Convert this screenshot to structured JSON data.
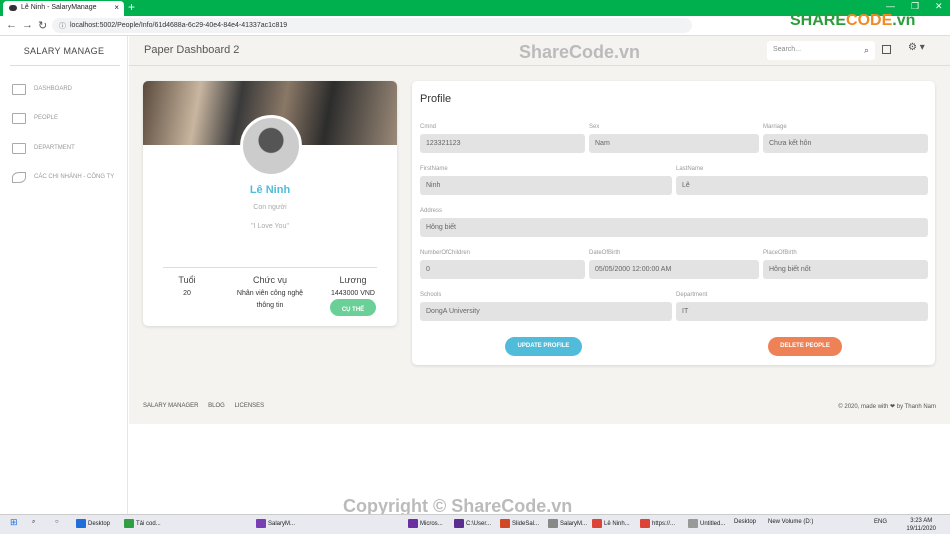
{
  "browser": {
    "tab_title": "Lê Ninh - SalaryManage",
    "url": "localhost:5002/People/Info/61d4688a-6c29-40e4-84e4-41337ac1c819"
  },
  "sidebar": {
    "brand": "SALARY MANAGE",
    "items": [
      {
        "label": "DASHBOARD",
        "icon": "bank-icon"
      },
      {
        "label": "PEOPLE",
        "icon": "id-card-icon"
      },
      {
        "label": "DEPARTMENT",
        "icon": "building-icon"
      },
      {
        "label": "CÁC CHI NHÁNH - CÔNG TY",
        "icon": "rocket-icon"
      }
    ]
  },
  "header": {
    "title": "Paper Dashboard 2",
    "search_placeholder": "Search..."
  },
  "user_card": {
    "name": "Lê Ninh",
    "role": "Con người",
    "quote": "\"I Love You\"",
    "stats": [
      {
        "label": "Tuổi",
        "value": "20"
      },
      {
        "label": "Chức vụ",
        "value": "Nhân viên công nghệ thông tin"
      },
      {
        "label": "Lương",
        "value": "1443000 VND"
      }
    ],
    "button": "CỤ THỂ"
  },
  "profile": {
    "title": "Profile",
    "fields": {
      "cmnd": {
        "label": "Cmnd",
        "value": "123321123"
      },
      "sex": {
        "label": "Sex",
        "value": "Nam"
      },
      "marriage": {
        "label": "Marriage",
        "value": "Chưa kết hôn"
      },
      "firstname": {
        "label": "FirstName",
        "value": "Ninh"
      },
      "lastname": {
        "label": "LastName",
        "value": "Lê"
      },
      "address": {
        "label": "Address",
        "value": "Hông biết"
      },
      "children": {
        "label": "NumberOfChildren",
        "value": "0"
      },
      "dob": {
        "label": "DateOfBirth",
        "value": "05/05/2000 12:00:00 AM"
      },
      "pob": {
        "label": "PlaceOfBirth",
        "value": "Hông biết nốt"
      },
      "schools": {
        "label": "Schools",
        "value": "DongA University"
      },
      "department": {
        "label": "Department",
        "value": "IT"
      }
    },
    "update_button": "UPDATE PROFILE",
    "delete_button": "DELETE PEOPLE"
  },
  "footer": {
    "links": [
      "SALARY MANAGER",
      "BLOG",
      "LICENSES"
    ],
    "copyright": "© 2020, made with ❤ by Thanh Nam"
  },
  "watermark": {
    "top": "ShareCode.vn",
    "bottom": "Copyright © ShareCode.vn",
    "logo_a": "SHARE",
    "logo_b": "CODE",
    "logo_c": ".vn"
  },
  "taskbar": {
    "items": [
      "Desktop",
      "Tải cod...",
      "SalaryM...",
      "Micros...",
      "C:\\User...",
      "SlideSal...",
      "SalaryM...",
      "Lê Ninh...",
      "https://...",
      "Untitled...",
      "Desktop",
      "New Volume (D:)"
    ],
    "lang": "ENG",
    "time": "3:23 AM",
    "date": "19/11/2020"
  }
}
